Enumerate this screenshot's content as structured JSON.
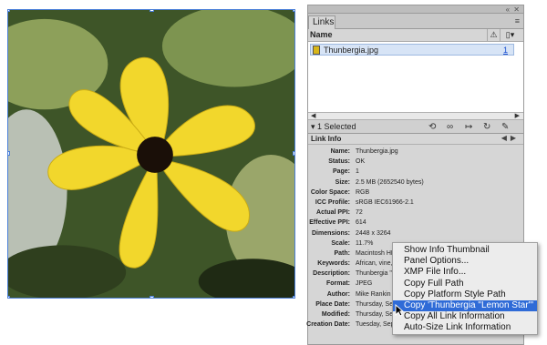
{
  "panel": {
    "title": "Links",
    "name_column": "Name",
    "files": [
      {
        "name": "Thunbergia.jpg",
        "page": "1"
      }
    ],
    "selection": "1 Selected",
    "link_info_title": "Link Info"
  },
  "link_info": [
    {
      "label": "Name:",
      "value": "Thunbergia.jpg"
    },
    {
      "label": "Status:",
      "value": "OK"
    },
    {
      "label": "Page:",
      "value": "1"
    },
    {
      "label": "Size:",
      "value": "2.5 MB (2652540 bytes)"
    },
    {
      "label": "Color Space:",
      "value": "RGB"
    },
    {
      "label": "ICC Profile:",
      "value": "sRGB IEC61966-2.1"
    },
    {
      "label": "Actual PPI:",
      "value": "72"
    },
    {
      "label": "Effective PPI:",
      "value": "614"
    },
    {
      "label": "Dimensions:",
      "value": "2448 x 3264"
    },
    {
      "label": "Scale:",
      "value": "11.7%"
    },
    {
      "label": "Path:",
      "value": "Macintosh HD:Users:Mike:Downloads:Thunbergia.jpg"
    },
    {
      "label": "Keywords:",
      "value": "African, vine, flower, black-eyed susan vine"
    },
    {
      "label": "Description:",
      "value": "Thunbergia \"Lemon Star\""
    },
    {
      "label": "Format:",
      "value": "JPEG"
    },
    {
      "label": "Author:",
      "value": "Mike Rankin"
    },
    {
      "label": "Place Date:",
      "value": "Thursday, Septem"
    },
    {
      "label": "Modified:",
      "value": "Thursday, Septem"
    },
    {
      "label": "Creation Date:",
      "value": "Tuesday, Septem"
    }
  ],
  "context_menu": {
    "items": [
      "Show Info Thumbnail",
      "Panel Options...",
      "XMP File Info...",
      "Copy Full Path",
      "Copy Platform Style Path",
      "Copy 'Thunbergia \"Lemon Star\"'",
      "Copy All Link Information",
      "Auto-Size Link Information"
    ],
    "highlighted_index": 5
  },
  "colors": {
    "selection_blue": "#2f6bd7",
    "frame_blue": "#4a7fd8",
    "petal_yellow": "#f2d72c",
    "flower_center": "#1a0f08"
  },
  "icons": [
    "warning-icon",
    "page-icon",
    "relink-icon",
    "link-icon",
    "goto-link-icon",
    "update-link-icon",
    "edit-original-icon"
  ]
}
